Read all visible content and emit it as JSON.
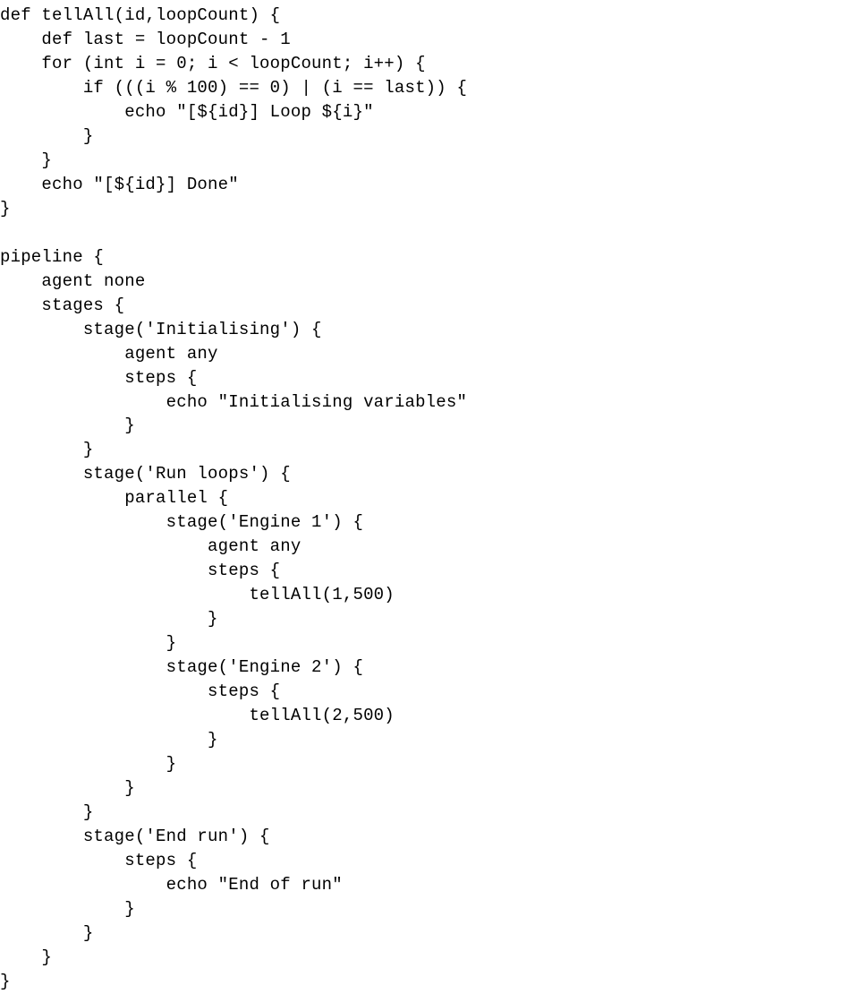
{
  "code": {
    "lines": [
      "def tellAll(id,loopCount) {",
      "    def last = loopCount - 1",
      "    for (int i = 0; i < loopCount; i++) {",
      "        if (((i % 100) == 0) | (i == last)) {",
      "            echo \"[${id}] Loop ${i}\"",
      "        }",
      "    }",
      "    echo \"[${id}] Done\"",
      "}",
      "",
      "pipeline {",
      "    agent none",
      "    stages {",
      "        stage('Initialising') {",
      "            agent any",
      "            steps {",
      "                echo \"Initialising variables\"",
      "            }",
      "        }",
      "        stage('Run loops') {",
      "            parallel {",
      "                stage('Engine 1') {",
      "                    agent any",
      "                    steps {",
      "                        tellAll(1,500)",
      "                    }",
      "                }",
      "                stage('Engine 2') {",
      "                    steps {",
      "                        tellAll(2,500)",
      "                    }",
      "                }",
      "            }",
      "        }",
      "        stage('End run') {",
      "            steps {",
      "                echo \"End of run\"",
      "            }",
      "        }",
      "    }",
      "}"
    ]
  }
}
